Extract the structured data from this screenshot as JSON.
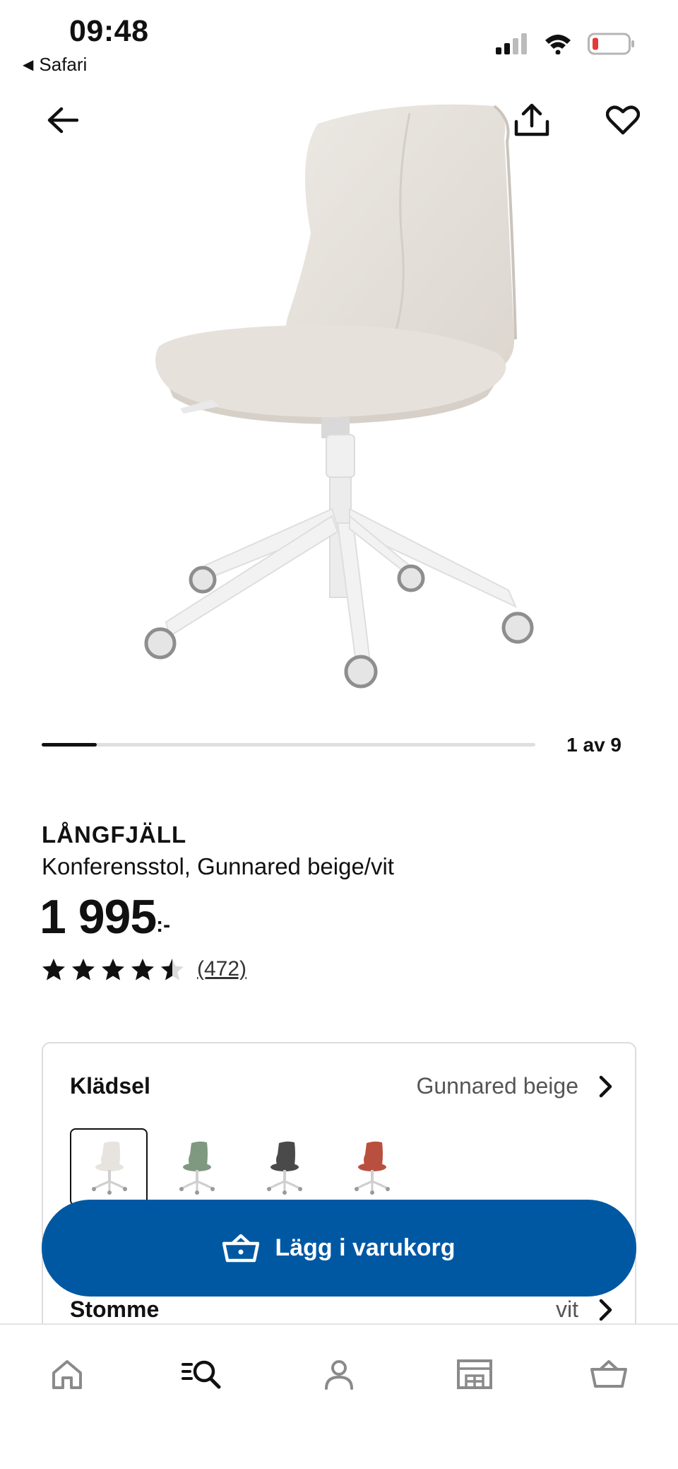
{
  "status_bar": {
    "time": "09:48",
    "back_app": "Safari"
  },
  "icons": {
    "back": "arrow-left-icon",
    "share": "share-icon",
    "favourite": "heart-icon",
    "cart": "basket-icon",
    "tabs": [
      "home-icon",
      "search-icon",
      "profile-icon",
      "store-icon",
      "basket-icon"
    ]
  },
  "carousel": {
    "counter": "1 av 9",
    "current": 1,
    "total": 9
  },
  "product": {
    "name": "LÅNGFJÄLL",
    "description": "Konferensstol, Gunnared beige/vit",
    "price": "1 995",
    "price_suffix": ":-",
    "rating": 4.5,
    "rating_max": 5,
    "review_count": "(472)"
  },
  "options": {
    "upholstery": {
      "label": "Klädsel",
      "value": "Gunnared beige",
      "swatches": [
        {
          "color": "#e7e3de",
          "selected": true
        },
        {
          "color": "#7f9880",
          "selected": false
        },
        {
          "color": "#4a4a4a",
          "selected": false
        },
        {
          "color": "#b9503f",
          "selected": false
        }
      ]
    },
    "frame": {
      "label": "Stomme",
      "value": "vit"
    }
  },
  "cta": {
    "label": "Lägg i varukorg",
    "color": "#0058a3"
  }
}
